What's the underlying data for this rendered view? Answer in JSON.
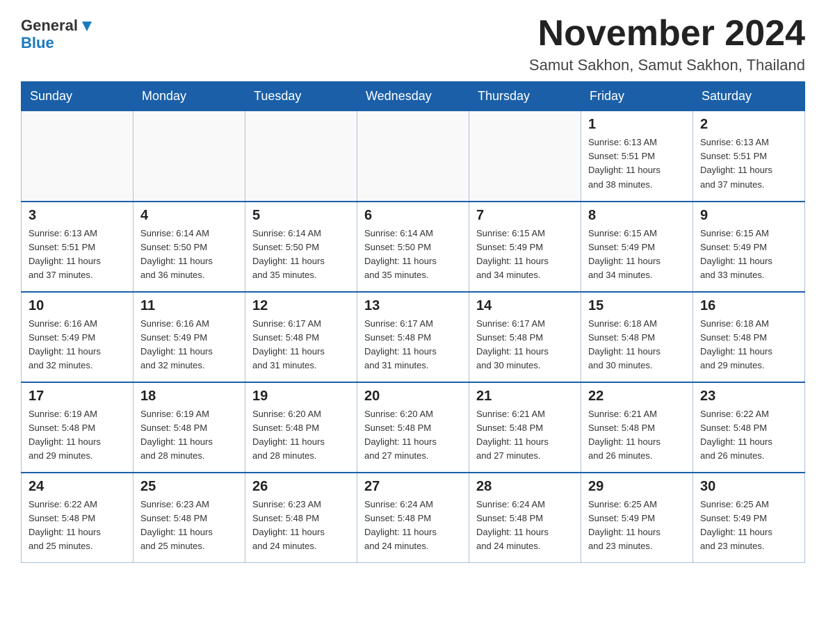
{
  "header": {
    "logo_line1": "General",
    "logo_line2": "Blue",
    "month_title": "November 2024",
    "location": "Samut Sakhon, Samut Sakhon, Thailand"
  },
  "days_of_week": [
    "Sunday",
    "Monday",
    "Tuesday",
    "Wednesday",
    "Thursday",
    "Friday",
    "Saturday"
  ],
  "weeks": [
    [
      {
        "day": "",
        "info": ""
      },
      {
        "day": "",
        "info": ""
      },
      {
        "day": "",
        "info": ""
      },
      {
        "day": "",
        "info": ""
      },
      {
        "day": "",
        "info": ""
      },
      {
        "day": "1",
        "info": "Sunrise: 6:13 AM\nSunset: 5:51 PM\nDaylight: 11 hours\nand 38 minutes."
      },
      {
        "day": "2",
        "info": "Sunrise: 6:13 AM\nSunset: 5:51 PM\nDaylight: 11 hours\nand 37 minutes."
      }
    ],
    [
      {
        "day": "3",
        "info": "Sunrise: 6:13 AM\nSunset: 5:51 PM\nDaylight: 11 hours\nand 37 minutes."
      },
      {
        "day": "4",
        "info": "Sunrise: 6:14 AM\nSunset: 5:50 PM\nDaylight: 11 hours\nand 36 minutes."
      },
      {
        "day": "5",
        "info": "Sunrise: 6:14 AM\nSunset: 5:50 PM\nDaylight: 11 hours\nand 35 minutes."
      },
      {
        "day": "6",
        "info": "Sunrise: 6:14 AM\nSunset: 5:50 PM\nDaylight: 11 hours\nand 35 minutes."
      },
      {
        "day": "7",
        "info": "Sunrise: 6:15 AM\nSunset: 5:49 PM\nDaylight: 11 hours\nand 34 minutes."
      },
      {
        "day": "8",
        "info": "Sunrise: 6:15 AM\nSunset: 5:49 PM\nDaylight: 11 hours\nand 34 minutes."
      },
      {
        "day": "9",
        "info": "Sunrise: 6:15 AM\nSunset: 5:49 PM\nDaylight: 11 hours\nand 33 minutes."
      }
    ],
    [
      {
        "day": "10",
        "info": "Sunrise: 6:16 AM\nSunset: 5:49 PM\nDaylight: 11 hours\nand 32 minutes."
      },
      {
        "day": "11",
        "info": "Sunrise: 6:16 AM\nSunset: 5:49 PM\nDaylight: 11 hours\nand 32 minutes."
      },
      {
        "day": "12",
        "info": "Sunrise: 6:17 AM\nSunset: 5:48 PM\nDaylight: 11 hours\nand 31 minutes."
      },
      {
        "day": "13",
        "info": "Sunrise: 6:17 AM\nSunset: 5:48 PM\nDaylight: 11 hours\nand 31 minutes."
      },
      {
        "day": "14",
        "info": "Sunrise: 6:17 AM\nSunset: 5:48 PM\nDaylight: 11 hours\nand 30 minutes."
      },
      {
        "day": "15",
        "info": "Sunrise: 6:18 AM\nSunset: 5:48 PM\nDaylight: 11 hours\nand 30 minutes."
      },
      {
        "day": "16",
        "info": "Sunrise: 6:18 AM\nSunset: 5:48 PM\nDaylight: 11 hours\nand 29 minutes."
      }
    ],
    [
      {
        "day": "17",
        "info": "Sunrise: 6:19 AM\nSunset: 5:48 PM\nDaylight: 11 hours\nand 29 minutes."
      },
      {
        "day": "18",
        "info": "Sunrise: 6:19 AM\nSunset: 5:48 PM\nDaylight: 11 hours\nand 28 minutes."
      },
      {
        "day": "19",
        "info": "Sunrise: 6:20 AM\nSunset: 5:48 PM\nDaylight: 11 hours\nand 28 minutes."
      },
      {
        "day": "20",
        "info": "Sunrise: 6:20 AM\nSunset: 5:48 PM\nDaylight: 11 hours\nand 27 minutes."
      },
      {
        "day": "21",
        "info": "Sunrise: 6:21 AM\nSunset: 5:48 PM\nDaylight: 11 hours\nand 27 minutes."
      },
      {
        "day": "22",
        "info": "Sunrise: 6:21 AM\nSunset: 5:48 PM\nDaylight: 11 hours\nand 26 minutes."
      },
      {
        "day": "23",
        "info": "Sunrise: 6:22 AM\nSunset: 5:48 PM\nDaylight: 11 hours\nand 26 minutes."
      }
    ],
    [
      {
        "day": "24",
        "info": "Sunrise: 6:22 AM\nSunset: 5:48 PM\nDaylight: 11 hours\nand 25 minutes."
      },
      {
        "day": "25",
        "info": "Sunrise: 6:23 AM\nSunset: 5:48 PM\nDaylight: 11 hours\nand 25 minutes."
      },
      {
        "day": "26",
        "info": "Sunrise: 6:23 AM\nSunset: 5:48 PM\nDaylight: 11 hours\nand 24 minutes."
      },
      {
        "day": "27",
        "info": "Sunrise: 6:24 AM\nSunset: 5:48 PM\nDaylight: 11 hours\nand 24 minutes."
      },
      {
        "day": "28",
        "info": "Sunrise: 6:24 AM\nSunset: 5:48 PM\nDaylight: 11 hours\nand 24 minutes."
      },
      {
        "day": "29",
        "info": "Sunrise: 6:25 AM\nSunset: 5:49 PM\nDaylight: 11 hours\nand 23 minutes."
      },
      {
        "day": "30",
        "info": "Sunrise: 6:25 AM\nSunset: 5:49 PM\nDaylight: 11 hours\nand 23 minutes."
      }
    ]
  ]
}
